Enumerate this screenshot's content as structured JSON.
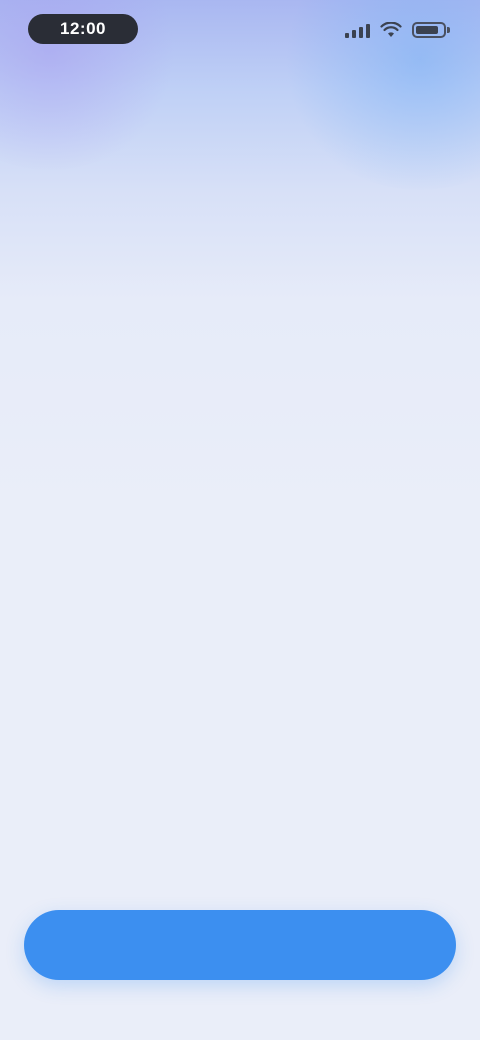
{
  "status_bar": {
    "time": "12:00",
    "battery_level": 0.85
  },
  "message": {
    "line1": "",
    "line2": ""
  },
  "primary_button": {
    "label": ""
  },
  "colors": {
    "accent": "#3c8ff0",
    "background": "#eaeef9",
    "gradient_top_left": "#a9b7f1",
    "gradient_top_right": "#8fbdf3"
  }
}
